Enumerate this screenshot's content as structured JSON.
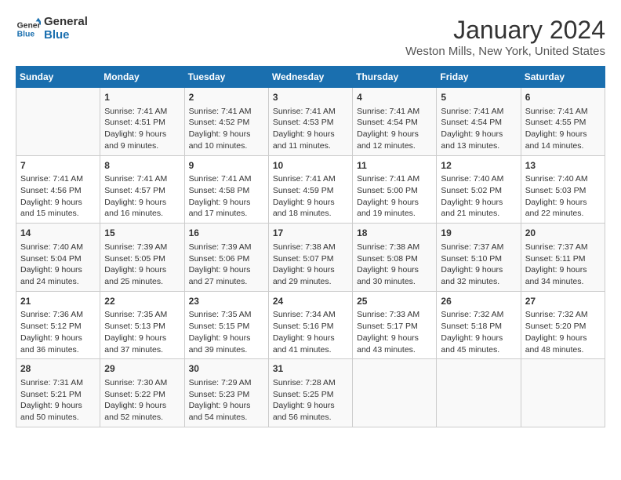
{
  "header": {
    "logo_line1": "General",
    "logo_line2": "Blue",
    "title": "January 2024",
    "subtitle": "Weston Mills, New York, United States"
  },
  "columns": [
    "Sunday",
    "Monday",
    "Tuesday",
    "Wednesday",
    "Thursday",
    "Friday",
    "Saturday"
  ],
  "weeks": [
    [
      {
        "day": "",
        "info": ""
      },
      {
        "day": "1",
        "info": "Sunrise: 7:41 AM\nSunset: 4:51 PM\nDaylight: 9 hours\nand 9 minutes."
      },
      {
        "day": "2",
        "info": "Sunrise: 7:41 AM\nSunset: 4:52 PM\nDaylight: 9 hours\nand 10 minutes."
      },
      {
        "day": "3",
        "info": "Sunrise: 7:41 AM\nSunset: 4:53 PM\nDaylight: 9 hours\nand 11 minutes."
      },
      {
        "day": "4",
        "info": "Sunrise: 7:41 AM\nSunset: 4:54 PM\nDaylight: 9 hours\nand 12 minutes."
      },
      {
        "day": "5",
        "info": "Sunrise: 7:41 AM\nSunset: 4:54 PM\nDaylight: 9 hours\nand 13 minutes."
      },
      {
        "day": "6",
        "info": "Sunrise: 7:41 AM\nSunset: 4:55 PM\nDaylight: 9 hours\nand 14 minutes."
      }
    ],
    [
      {
        "day": "7",
        "info": "Sunrise: 7:41 AM\nSunset: 4:56 PM\nDaylight: 9 hours\nand 15 minutes."
      },
      {
        "day": "8",
        "info": "Sunrise: 7:41 AM\nSunset: 4:57 PM\nDaylight: 9 hours\nand 16 minutes."
      },
      {
        "day": "9",
        "info": "Sunrise: 7:41 AM\nSunset: 4:58 PM\nDaylight: 9 hours\nand 17 minutes."
      },
      {
        "day": "10",
        "info": "Sunrise: 7:41 AM\nSunset: 4:59 PM\nDaylight: 9 hours\nand 18 minutes."
      },
      {
        "day": "11",
        "info": "Sunrise: 7:41 AM\nSunset: 5:00 PM\nDaylight: 9 hours\nand 19 minutes."
      },
      {
        "day": "12",
        "info": "Sunrise: 7:40 AM\nSunset: 5:02 PM\nDaylight: 9 hours\nand 21 minutes."
      },
      {
        "day": "13",
        "info": "Sunrise: 7:40 AM\nSunset: 5:03 PM\nDaylight: 9 hours\nand 22 minutes."
      }
    ],
    [
      {
        "day": "14",
        "info": "Sunrise: 7:40 AM\nSunset: 5:04 PM\nDaylight: 9 hours\nand 24 minutes."
      },
      {
        "day": "15",
        "info": "Sunrise: 7:39 AM\nSunset: 5:05 PM\nDaylight: 9 hours\nand 25 minutes."
      },
      {
        "day": "16",
        "info": "Sunrise: 7:39 AM\nSunset: 5:06 PM\nDaylight: 9 hours\nand 27 minutes."
      },
      {
        "day": "17",
        "info": "Sunrise: 7:38 AM\nSunset: 5:07 PM\nDaylight: 9 hours\nand 29 minutes."
      },
      {
        "day": "18",
        "info": "Sunrise: 7:38 AM\nSunset: 5:08 PM\nDaylight: 9 hours\nand 30 minutes."
      },
      {
        "day": "19",
        "info": "Sunrise: 7:37 AM\nSunset: 5:10 PM\nDaylight: 9 hours\nand 32 minutes."
      },
      {
        "day": "20",
        "info": "Sunrise: 7:37 AM\nSunset: 5:11 PM\nDaylight: 9 hours\nand 34 minutes."
      }
    ],
    [
      {
        "day": "21",
        "info": "Sunrise: 7:36 AM\nSunset: 5:12 PM\nDaylight: 9 hours\nand 36 minutes."
      },
      {
        "day": "22",
        "info": "Sunrise: 7:35 AM\nSunset: 5:13 PM\nDaylight: 9 hours\nand 37 minutes."
      },
      {
        "day": "23",
        "info": "Sunrise: 7:35 AM\nSunset: 5:15 PM\nDaylight: 9 hours\nand 39 minutes."
      },
      {
        "day": "24",
        "info": "Sunrise: 7:34 AM\nSunset: 5:16 PM\nDaylight: 9 hours\nand 41 minutes."
      },
      {
        "day": "25",
        "info": "Sunrise: 7:33 AM\nSunset: 5:17 PM\nDaylight: 9 hours\nand 43 minutes."
      },
      {
        "day": "26",
        "info": "Sunrise: 7:32 AM\nSunset: 5:18 PM\nDaylight: 9 hours\nand 45 minutes."
      },
      {
        "day": "27",
        "info": "Sunrise: 7:32 AM\nSunset: 5:20 PM\nDaylight: 9 hours\nand 48 minutes."
      }
    ],
    [
      {
        "day": "28",
        "info": "Sunrise: 7:31 AM\nSunset: 5:21 PM\nDaylight: 9 hours\nand 50 minutes."
      },
      {
        "day": "29",
        "info": "Sunrise: 7:30 AM\nSunset: 5:22 PM\nDaylight: 9 hours\nand 52 minutes."
      },
      {
        "day": "30",
        "info": "Sunrise: 7:29 AM\nSunset: 5:23 PM\nDaylight: 9 hours\nand 54 minutes."
      },
      {
        "day": "31",
        "info": "Sunrise: 7:28 AM\nSunset: 5:25 PM\nDaylight: 9 hours\nand 56 minutes."
      },
      {
        "day": "",
        "info": ""
      },
      {
        "day": "",
        "info": ""
      },
      {
        "day": "",
        "info": ""
      }
    ]
  ]
}
